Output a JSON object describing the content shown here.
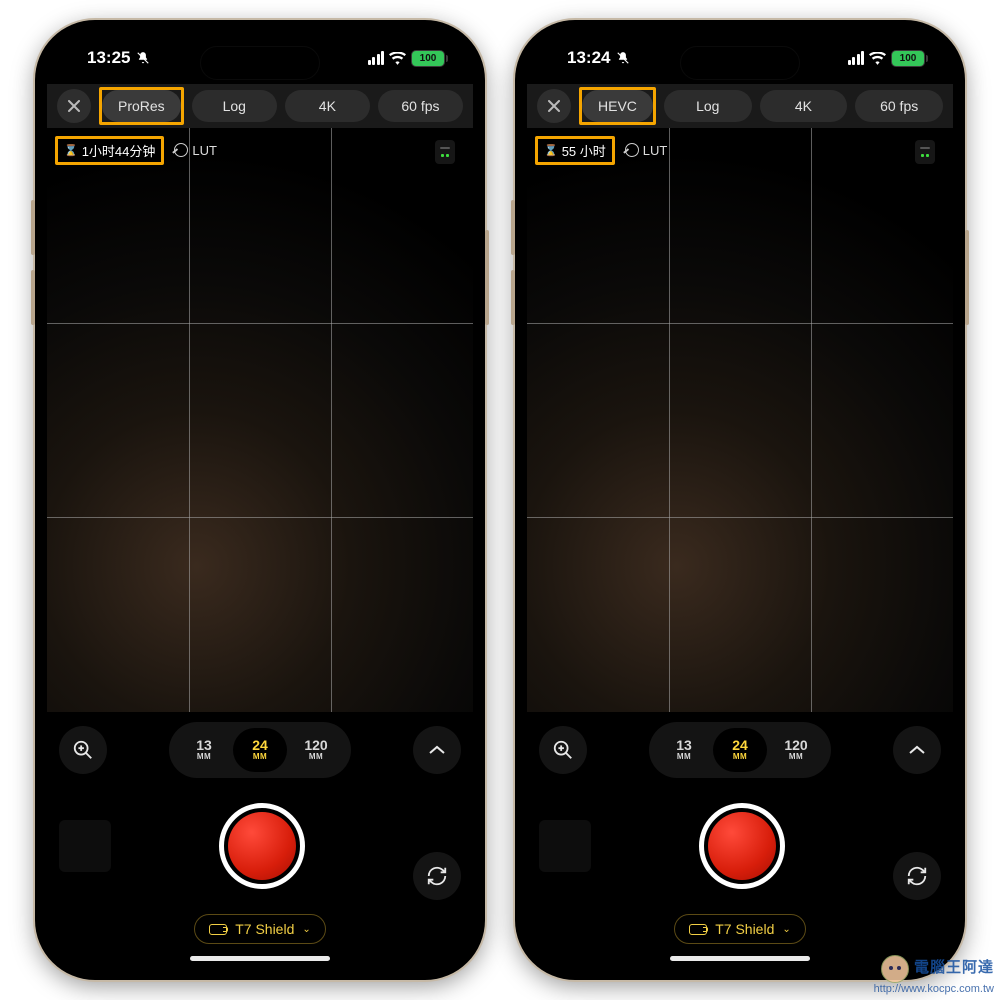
{
  "phones": [
    {
      "status": {
        "time": "13:25",
        "battery": "100"
      },
      "settings": {
        "codec": "ProRes",
        "profile": "Log",
        "resolution": "4K",
        "framerate": "60 fps"
      },
      "recording_time": "1小时44分钟",
      "lut_label": "LUT",
      "lenses": [
        {
          "focal": "13",
          "unit": "MM",
          "active": false
        },
        {
          "focal": "24",
          "unit": "MM",
          "active": true
        },
        {
          "focal": "120",
          "unit": "MM",
          "active": false
        }
      ],
      "storage_label": "T7 Shield"
    },
    {
      "status": {
        "time": "13:24",
        "battery": "100"
      },
      "settings": {
        "codec": "HEVC",
        "profile": "Log",
        "resolution": "4K",
        "framerate": "60 fps"
      },
      "recording_time": "55 小时",
      "lut_label": "LUT",
      "lenses": [
        {
          "focal": "13",
          "unit": "MM",
          "active": false
        },
        {
          "focal": "24",
          "unit": "MM",
          "active": true
        },
        {
          "focal": "120",
          "unit": "MM",
          "active": false
        }
      ],
      "storage_label": "T7 Shield"
    }
  ],
  "watermark": {
    "title": "電腦王阿達",
    "url": "http://www.kocpc.com.tw"
  }
}
